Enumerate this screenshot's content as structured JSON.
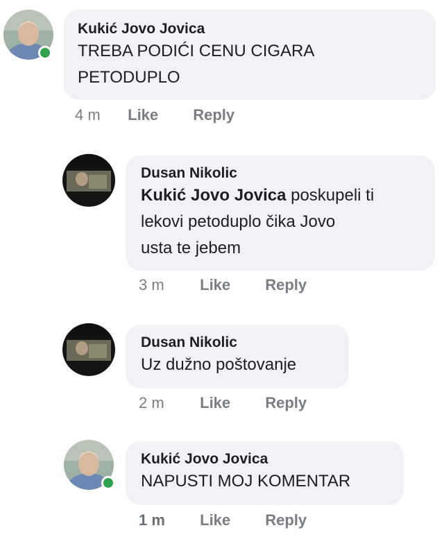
{
  "comments": [
    {
      "author": "Kukić Jovo Jovica",
      "text_line1": "TREBA PODIĆI CENU CIGARA",
      "text_line2": "PETODUPLO",
      "time": "4 m",
      "like": "Like",
      "reply": "Reply",
      "online": true
    },
    {
      "author": "Dusan Nikolic",
      "mention": "Kukić Jovo Jovica",
      "text_line1_rest": " poskupeli ti",
      "text_line2": "lekovi petoduplo čika Jovo",
      "text_line3": "usta te jebem",
      "time": "3 m",
      "like": "Like",
      "reply": "Reply"
    },
    {
      "author": "Dusan Nikolic",
      "text": "Uz dužno poštovanje",
      "time": "2 m",
      "like": "Like",
      "reply": "Reply"
    },
    {
      "author": "Kukić Jovo Jovica",
      "text": "NAPUSTI MOJ KOMENTAR",
      "time": "1 m",
      "like": "Like",
      "reply": "Reply",
      "online": true
    }
  ],
  "colors": {
    "bubble": "#f0f2f5",
    "online": "#31a24c",
    "meta": "#7a7d82"
  }
}
